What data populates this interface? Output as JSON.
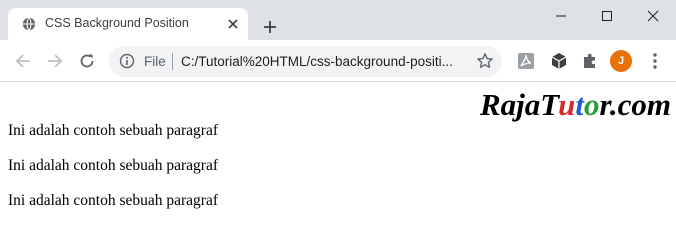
{
  "browser": {
    "tab_title": "CSS Background Position",
    "omnibox": {
      "scheme_label": "File",
      "url": "C:/Tutorial%20HTML/css-background-positi..."
    },
    "profile_initial": "J"
  },
  "page": {
    "logo": {
      "text_part1": "Raja",
      "text_part2": "Tutor",
      "text_part3": ".com"
    },
    "paragraphs": [
      "Ini adalah contoh sebuah paragraf",
      "Ini adalah contoh sebuah paragraf",
      "Ini adalah contoh sebuah paragraf"
    ]
  },
  "icons": {
    "tab_favicon": "globe-icon",
    "tab_close": "close-icon",
    "new_tab": "plus-icon",
    "minimize": "minimize-icon",
    "maximize": "maximize-icon",
    "window_close": "close-icon",
    "back": "arrow-left-icon",
    "forward": "arrow-right-icon",
    "reload": "reload-icon",
    "site_info": "info-icon",
    "bookmark": "star-icon",
    "ext_pdf": "pdf-icon",
    "ext_box": "cube-icon",
    "extensions": "puzzle-icon",
    "menu": "kebab-icon"
  },
  "colors": {
    "tabstrip_bg": "#dee1e6",
    "omnibox_bg": "#f1f3f4",
    "avatar_bg": "#e8710a",
    "logo_fill": "#000000",
    "logo_accent_red": "#d62828",
    "logo_accent_blue": "#1f5fd6",
    "logo_accent_green": "#2a9d3a"
  }
}
